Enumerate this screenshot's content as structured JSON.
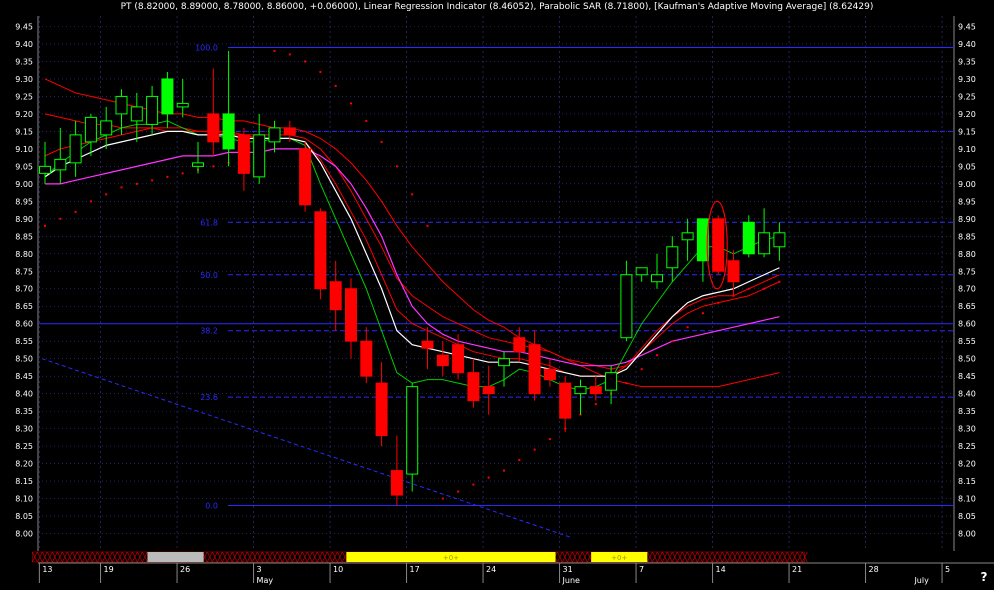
{
  "header": {
    "title": "PT (8.82000, 8.89000, 8.78000, 8.86000, +0.06000), Linear Regression Indicator (8.46052), Parabolic SAR (8.71800), [Kaufman's Adaptive Moving Average] (8.62429)"
  },
  "help_label": "?",
  "colors": {
    "background": "#000000",
    "up_candle": "#00ff00",
    "down_candle": "#ff0000",
    "fib_line": "#2a2aff",
    "grid": "#3a3a9a",
    "lin_reg": "#00cc00",
    "kama": "#ffffff",
    "ma_magenta": "#ff33ff",
    "sar": "#ff0000",
    "highlight_yellow": "#ffff00",
    "highlight_gray": "#bbbbbb",
    "hatch": "#cc0000"
  },
  "chart_data": {
    "type": "candlestick",
    "ylim": [
      7.95,
      9.48
    ],
    "y_ticks": [
      "9.45",
      "9.40",
      "9.35",
      "9.30",
      "9.25",
      "9.20",
      "9.15",
      "9.10",
      "9.05",
      "9.00",
      "8.95",
      "8.90",
      "8.85",
      "8.80",
      "8.75",
      "8.70",
      "8.65",
      "8.60",
      "8.55",
      "8.50",
      "8.45",
      "8.40",
      "8.35",
      "8.30",
      "8.25",
      "8.20",
      "8.15",
      "8.10",
      "8.05",
      "8.00"
    ],
    "x_day_labels": [
      {
        "label": "13",
        "slot": 0
      },
      {
        "label": "19",
        "slot": 4
      },
      {
        "label": "26",
        "slot": 9
      },
      {
        "label": "3",
        "slot": 14
      },
      {
        "label": "10",
        "slot": 19
      },
      {
        "label": "17",
        "slot": 24
      },
      {
        "label": "24",
        "slot": 29
      },
      {
        "label": "31",
        "slot": 34
      },
      {
        "label": "7",
        "slot": 39
      },
      {
        "label": "14",
        "slot": 44
      },
      {
        "label": "21",
        "slot": 49
      },
      {
        "label": "28",
        "slot": 54
      },
      {
        "label": "5",
        "slot": 59
      }
    ],
    "x_month_labels": [
      {
        "label": "May",
        "slot": 14
      },
      {
        "label": "June",
        "slot": 34
      },
      {
        "label": "July",
        "slot": 57
      }
    ],
    "candles": [
      {
        "o": 9.03,
        "h": 9.12,
        "l": 9.0,
        "c": 9.05
      },
      {
        "o": 9.04,
        "h": 9.16,
        "l": 9.0,
        "c": 9.07
      },
      {
        "o": 9.06,
        "h": 9.18,
        "l": 9.02,
        "c": 9.14
      },
      {
        "o": 9.12,
        "h": 9.2,
        "l": 9.08,
        "c": 9.19
      },
      {
        "o": 9.14,
        "h": 9.22,
        "l": 9.1,
        "c": 9.18
      },
      {
        "o": 9.2,
        "h": 9.27,
        "l": 9.14,
        "c": 9.25
      },
      {
        "o": 9.18,
        "h": 9.26,
        "l": 9.12,
        "c": 9.22
      },
      {
        "o": 9.17,
        "h": 9.28,
        "l": 9.14,
        "c": 9.25
      },
      {
        "o": 9.2,
        "h": 9.32,
        "l": 9.16,
        "c": 9.3
      },
      {
        "o": 9.22,
        "h": 9.3,
        "l": 9.19,
        "c": 9.23
      },
      {
        "o": 9.05,
        "h": 9.12,
        "l": 9.03,
        "c": 9.06
      },
      {
        "o": 9.2,
        "h": 9.33,
        "l": 9.08,
        "c": 9.12
      },
      {
        "o": 9.1,
        "h": 9.38,
        "l": 9.05,
        "c": 9.2
      },
      {
        "o": 9.14,
        "h": 9.16,
        "l": 8.98,
        "c": 9.03
      },
      {
        "o": 9.02,
        "h": 9.2,
        "l": 9.0,
        "c": 9.14
      },
      {
        "o": 9.12,
        "h": 9.18,
        "l": 9.09,
        "c": 9.16
      },
      {
        "o": 9.16,
        "h": 9.18,
        "l": 9.12,
        "c": 9.14
      },
      {
        "o": 9.1,
        "h": 9.12,
        "l": 8.92,
        "c": 8.94
      },
      {
        "o": 8.92,
        "h": 8.93,
        "l": 8.67,
        "c": 8.7
      },
      {
        "o": 8.72,
        "h": 8.78,
        "l": 8.58,
        "c": 8.64
      },
      {
        "o": 8.7,
        "h": 8.73,
        "l": 8.5,
        "c": 8.55
      },
      {
        "o": 8.55,
        "h": 8.59,
        "l": 8.43,
        "c": 8.45
      },
      {
        "o": 8.43,
        "h": 8.49,
        "l": 8.25,
        "c": 8.28
      },
      {
        "o": 8.18,
        "h": 8.28,
        "l": 8.08,
        "c": 8.11
      },
      {
        "o": 8.17,
        "h": 8.43,
        "l": 8.12,
        "c": 8.42
      },
      {
        "o": 8.55,
        "h": 8.59,
        "l": 8.47,
        "c": 8.53
      },
      {
        "o": 8.51,
        "h": 8.55,
        "l": 8.45,
        "c": 8.48
      },
      {
        "o": 8.54,
        "h": 8.57,
        "l": 8.44,
        "c": 8.46
      },
      {
        "o": 8.46,
        "h": 8.5,
        "l": 8.36,
        "c": 8.38
      },
      {
        "o": 8.42,
        "h": 8.48,
        "l": 8.34,
        "c": 8.4
      },
      {
        "o": 8.48,
        "h": 8.52,
        "l": 8.42,
        "c": 8.5
      },
      {
        "o": 8.56,
        "h": 8.59,
        "l": 8.49,
        "c": 8.52
      },
      {
        "o": 8.54,
        "h": 8.58,
        "l": 8.38,
        "c": 8.4
      },
      {
        "o": 8.47,
        "h": 8.5,
        "l": 8.42,
        "c": 8.44
      },
      {
        "o": 8.43,
        "h": 8.45,
        "l": 8.29,
        "c": 8.33
      },
      {
        "o": 8.4,
        "h": 8.44,
        "l": 8.34,
        "c": 8.42
      },
      {
        "o": 8.42,
        "h": 8.45,
        "l": 8.38,
        "c": 8.4
      },
      {
        "o": 8.41,
        "h": 8.48,
        "l": 8.37,
        "c": 8.46
      },
      {
        "o": 8.56,
        "h": 8.78,
        "l": 8.55,
        "c": 8.74
      },
      {
        "o": 8.74,
        "h": 8.76,
        "l": 8.72,
        "c": 8.76
      },
      {
        "o": 8.72,
        "h": 8.8,
        "l": 8.7,
        "c": 8.74
      },
      {
        "o": 8.76,
        "h": 8.85,
        "l": 8.72,
        "c": 8.82
      },
      {
        "o": 8.84,
        "h": 8.9,
        "l": 8.78,
        "c": 8.86
      },
      {
        "o": 8.78,
        "h": 8.9,
        "l": 8.72,
        "c": 8.9
      },
      {
        "o": 8.9,
        "h": 8.91,
        "l": 8.74,
        "c": 8.75
      },
      {
        "o": 8.78,
        "h": 8.81,
        "l": 8.68,
        "c": 8.72
      },
      {
        "o": 8.8,
        "h": 8.91,
        "l": 8.79,
        "c": 8.89
      },
      {
        "o": 8.8,
        "h": 8.93,
        "l": 8.79,
        "c": 8.86
      },
      {
        "o": 8.82,
        "h": 8.89,
        "l": 8.78,
        "c": 8.86
      }
    ],
    "kama": [
      9.02,
      9.05,
      9.07,
      9.09,
      9.11,
      9.12,
      9.13,
      9.14,
      9.15,
      9.15,
      9.14,
      9.14,
      9.14,
      9.13,
      9.13,
      9.13,
      9.13,
      9.12,
      9.06,
      8.98,
      8.9,
      8.8,
      8.7,
      8.58,
      8.54,
      8.53,
      8.52,
      8.51,
      8.5,
      8.49,
      8.49,
      8.49,
      8.48,
      8.47,
      8.46,
      8.45,
      8.45,
      8.45,
      8.47,
      8.52,
      8.57,
      8.62,
      8.66,
      8.68,
      8.69,
      8.7,
      8.72,
      8.74,
      8.76
    ],
    "lin_reg": [
      9.02,
      9.06,
      9.09,
      9.12,
      9.14,
      9.16,
      9.17,
      9.17,
      9.18,
      9.16,
      9.14,
      9.14,
      9.13,
      9.12,
      9.12,
      9.13,
      9.13,
      9.11,
      9.0,
      8.9,
      8.8,
      8.7,
      8.58,
      8.46,
      8.43,
      8.44,
      8.44,
      8.43,
      8.42,
      8.42,
      8.44,
      8.47,
      8.46,
      8.44,
      8.42,
      8.41,
      8.42,
      8.44,
      8.52,
      8.6,
      8.66,
      8.72,
      8.77,
      8.82,
      8.82,
      8.8,
      8.82,
      8.84,
      8.85
    ],
    "ma_magenta": [
      9.0,
      9.0,
      9.01,
      9.02,
      9.03,
      9.04,
      9.05,
      9.06,
      9.07,
      9.08,
      9.08,
      9.08,
      9.09,
      9.09,
      9.09,
      9.1,
      9.1,
      9.1,
      9.08,
      9.05,
      9.0,
      8.93,
      8.85,
      8.74,
      8.65,
      8.6,
      8.57,
      8.55,
      8.54,
      8.53,
      8.52,
      8.52,
      8.51,
      8.5,
      8.49,
      8.48,
      8.48,
      8.48,
      8.49,
      8.51,
      8.53,
      8.55,
      8.56,
      8.57,
      8.58,
      8.59,
      8.6,
      8.61,
      8.62
    ],
    "ma_red_fast": [
      9.08,
      9.1,
      9.11,
      9.12,
      9.13,
      9.14,
      9.15,
      9.16,
      9.16,
      9.16,
      9.15,
      9.15,
      9.14,
      9.14,
      9.13,
      9.13,
      9.13,
      9.12,
      9.07,
      9.0,
      8.92,
      8.84,
      8.74,
      8.64,
      8.6,
      8.58,
      8.56,
      8.54,
      8.52,
      8.51,
      8.5,
      8.5,
      8.49,
      8.48,
      8.46,
      8.45,
      8.45,
      8.45,
      8.48,
      8.53,
      8.58,
      8.62,
      8.65,
      8.67,
      8.68,
      8.68,
      8.7,
      8.72,
      8.74
    ],
    "ma_red_mid": [
      9.2,
      9.19,
      9.18,
      9.17,
      9.17,
      9.16,
      9.16,
      9.16,
      9.15,
      9.15,
      9.15,
      9.15,
      9.15,
      9.14,
      9.14,
      9.14,
      9.14,
      9.13,
      9.1,
      9.05,
      8.98,
      8.9,
      8.82,
      8.73,
      8.68,
      8.65,
      8.62,
      8.6,
      8.58,
      8.56,
      8.55,
      8.54,
      8.53,
      8.52,
      8.5,
      8.49,
      8.48,
      8.47,
      8.48,
      8.52,
      8.56,
      8.6,
      8.63,
      8.65,
      8.66,
      8.67,
      8.68,
      8.7,
      8.72
    ],
    "ma_red_slow": [
      9.3,
      9.28,
      9.26,
      9.25,
      9.24,
      9.23,
      9.22,
      9.21,
      9.2,
      9.2,
      9.19,
      9.19,
      9.18,
      9.18,
      9.17,
      9.16,
      9.16,
      9.15,
      9.13,
      9.1,
      9.06,
      9.01,
      8.95,
      8.88,
      8.82,
      8.77,
      8.72,
      8.68,
      8.64,
      8.61,
      8.59,
      8.56,
      8.54,
      8.52,
      8.5,
      8.48,
      8.46,
      8.44,
      8.43,
      8.42,
      8.42,
      8.42,
      8.42,
      8.42,
      8.42,
      8.43,
      8.44,
      8.45,
      8.46
    ],
    "sar": [
      8.88,
      8.9,
      8.92,
      8.95,
      8.97,
      8.99,
      9.0,
      9.01,
      9.02,
      9.03,
      9.04,
      9.05,
      9.06,
      9.07,
      9.08,
      9.38,
      9.37,
      9.35,
      9.32,
      9.28,
      9.23,
      9.18,
      9.12,
      9.05,
      8.97,
      8.88,
      8.1,
      8.12,
      8.14,
      8.16,
      8.18,
      8.21,
      8.24,
      8.27,
      8.3,
      8.34,
      8.37,
      8.4,
      8.43,
      8.47,
      8.51,
      8.55,
      8.59,
      8.63,
      8.66,
      8.68,
      8.7,
      8.7,
      8.72
    ],
    "fib_levels": [
      {
        "label": "100.0",
        "value": 9.39,
        "style": "solid"
      },
      {
        "label": "",
        "value": 9.15,
        "style": "dashed"
      },
      {
        "label": "61.8",
        "value": 8.89,
        "style": "dashed"
      },
      {
        "label": "50.0",
        "value": 8.74,
        "style": "dashed"
      },
      {
        "label": "",
        "value": 8.6,
        "style": "solid"
      },
      {
        "label": "38.2",
        "value": 8.58,
        "style": "dashed"
      },
      {
        "label": "23.6",
        "value": 8.39,
        "style": "dashed"
      },
      {
        "label": "0.0",
        "value": 8.08,
        "style": "solid"
      }
    ],
    "trendline": {
      "x1": 0,
      "y1": 8.5,
      "x2": 33,
      "y2": 7.99
    },
    "highlight_candle_index": 44,
    "bottom_bands": [
      {
        "start": 7,
        "end": 10,
        "type": "gray"
      },
      {
        "start": 20,
        "end": 33,
        "type": "yellow",
        "label": "+0+"
      },
      {
        "start": 36,
        "end": 39,
        "type": "yellow",
        "label": "+0+"
      }
    ],
    "band_hatch_range": [
      0,
      49
    ]
  }
}
